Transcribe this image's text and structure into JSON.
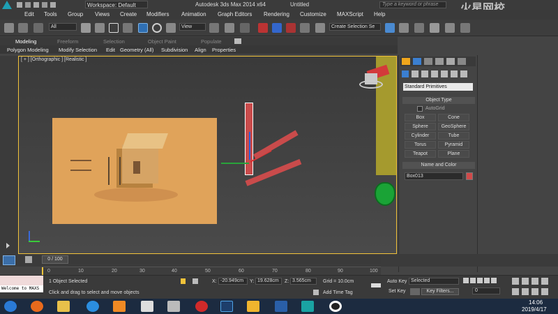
{
  "titlebar": {
    "workspace_label": "Workspace: Default",
    "app_title": "Autodesk 3ds Max  2014 x64",
    "doc_title": "Untitled",
    "search_placeholder": "Type a keyword or phrase",
    "watermark": "火星网校"
  },
  "menu": [
    "Edit",
    "Tools",
    "Group",
    "Views",
    "Create",
    "Modifiers",
    "Animation",
    "Graph Editors",
    "Rendering",
    "Customize",
    "MAXScript",
    "Help"
  ],
  "toolbar": {
    "filter_value": "All",
    "view_value": "View",
    "selection_set_placeholder": "Create Selection Se"
  },
  "ribbon": {
    "tabs": [
      "Modeling",
      "Freeform",
      "Selection",
      "Object Paint",
      "Populate"
    ],
    "subtabs": [
      "Polygon Modeling",
      "Modify Selection",
      "Edit",
      "Geometry (All)",
      "Subdivision",
      "Align",
      "Properties"
    ]
  },
  "viewport": {
    "label": "[ + ] [Orthographic ] [Realistic ]"
  },
  "cmdpanel": {
    "category": "Standard Primitives",
    "object_type_title": "Object Type",
    "autogrid_label": "AutoGrid",
    "buttons": [
      "Box",
      "Cone",
      "Sphere",
      "GeoSphere",
      "Cylinder",
      "Tube",
      "Torus",
      "Pyramid",
      "Teapot",
      "Plane"
    ],
    "name_color_title": "Name and Color",
    "object_name": "Box013",
    "object_color": "#d04a4a"
  },
  "timeline": {
    "frame_label": "0 / 100",
    "ticks": [
      "0",
      "10",
      "20",
      "30",
      "40",
      "50",
      "60",
      "70",
      "80",
      "90",
      "100"
    ]
  },
  "status": {
    "maxscript_text": "Welcome to MAXS",
    "selected_text": "1 Object Selected",
    "prompt_text": "Click and drag to select and move objects",
    "x_label": "X:",
    "x_value": "-20.949cm",
    "y_label": "Y:",
    "y_value": "19.628cm",
    "z_label": "Z:",
    "z_value": "3.565cm",
    "grid": "Grid = 10.0cm",
    "add_time_tag": "Add Time Tag",
    "auto_key": "Auto Key",
    "set_key": "Set Key",
    "key_mode": "Selected",
    "key_filters": "Key Filters...",
    "frame_value": "0"
  },
  "taskbar": {
    "time": "14:06",
    "date": "2019/4/17"
  }
}
